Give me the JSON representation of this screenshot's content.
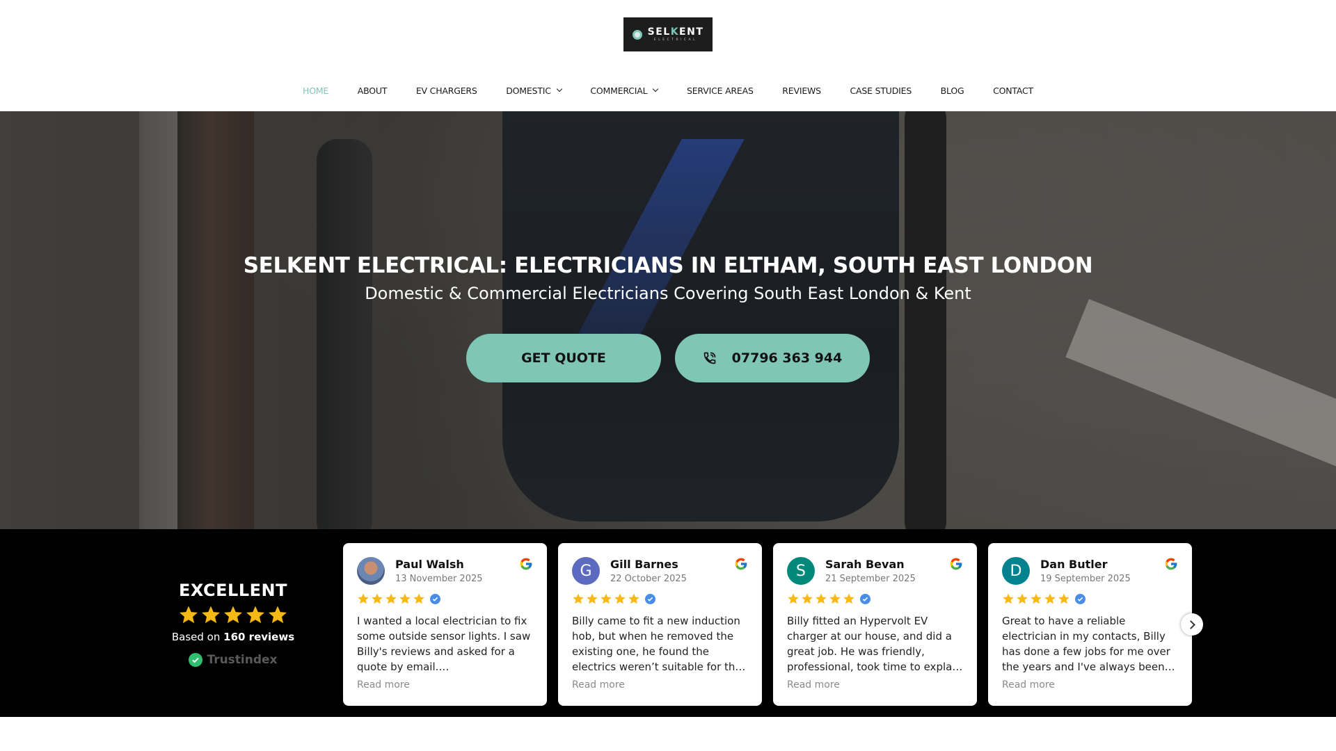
{
  "brand": {
    "logo_main_1": "SEL",
    "logo_main_accent": "K",
    "logo_main_2": "ENT",
    "logo_sub": "ELECTRICAL",
    "accent_color": "#7fc6b6"
  },
  "nav": {
    "items": [
      {
        "label": "HOME",
        "active": true
      },
      {
        "label": "ABOUT"
      },
      {
        "label": "EV CHARGERS"
      },
      {
        "label": "DOMESTIC",
        "dropdown": true
      },
      {
        "label": "COMMERCIAL",
        "dropdown": true
      },
      {
        "label": "SERVICE AREAS"
      },
      {
        "label": "REVIEWS"
      },
      {
        "label": "CASE STUDIES"
      },
      {
        "label": "BLOG"
      },
      {
        "label": "CONTACT"
      }
    ]
  },
  "hero": {
    "title": "SELKENT ELECTRICAL: ELECTRICIANS IN ELTHAM, SOUTH EAST LONDON",
    "subtitle": "Domestic & Commercial Electricians Covering South East London & Kent",
    "quote_button": "GET QUOTE",
    "phone_button": "07796 363 944",
    "phone_icon": "phone-icon"
  },
  "reviews_summary": {
    "rating_word": "EXCELLENT",
    "stars": 5,
    "based_on_prefix": "Based on ",
    "review_count": "160 reviews",
    "provider": "Trustindex"
  },
  "reviews": [
    {
      "name": "Paul Walsh",
      "date": "13 November 2025",
      "initial": "",
      "avatar_color": "#6b86b3",
      "stars": 5,
      "text": "I wanted a local electrician to fix some outside sensor lights. I saw Billy's reviews and asked for a quote by email.…",
      "read_more": "Read more"
    },
    {
      "name": "Gill Barnes",
      "date": "22 October 2025",
      "initial": "G",
      "avatar_color": "#5c6bc0",
      "stars": 5,
      "text": "Billy came to fit a new induction hob, but when he removed the existing one, he found the electrics weren’t suitable for th…",
      "read_more": "Read more"
    },
    {
      "name": "Sarah Bevan",
      "date": "21 September 2025",
      "initial": "S",
      "avatar_color": "#00897b",
      "stars": 5,
      "text": "Billy fitted an Hypervolt EV charger at our house, and did a great job. He was friendly, professional, took time to expla…",
      "read_more": "Read more"
    },
    {
      "name": "Dan Butler",
      "date": "19 September 2025",
      "initial": "D",
      "avatar_color": "#00838f",
      "stars": 5,
      "text": "Great to have a reliable electrician in my contacts, Billy has done a few jobs for me over the years and I've always been…",
      "read_more": "Read more"
    }
  ]
}
